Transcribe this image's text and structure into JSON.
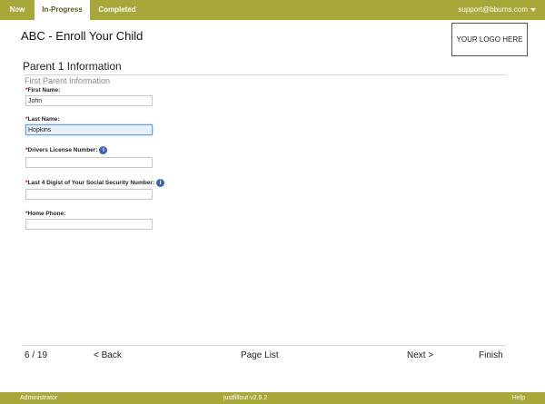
{
  "tabs": [
    {
      "label": "New"
    },
    {
      "label": "In-Progress"
    },
    {
      "label": "Completed"
    }
  ],
  "account": {
    "email": "support@bburns.com"
  },
  "page_title": "ABC - Enroll Your Child",
  "logo_text": "YOUR LOGO HERE",
  "section": {
    "title": "Parent 1 Information",
    "subtitle": "First Parent Information"
  },
  "required_marker": "*",
  "fields": [
    {
      "label": "First Name:",
      "value": "John"
    },
    {
      "label": "Last Name:",
      "value": "Hopkins"
    },
    {
      "label": "Drivers License Number:",
      "value": ""
    },
    {
      "label": "Last 4 Digist of Your Social Security Number:",
      "value": ""
    },
    {
      "label": "Home Phone:",
      "value": ""
    }
  ],
  "nav": {
    "page_counter": "6 / 19",
    "back": "< Back",
    "page_list": "Page List",
    "next": "Next >",
    "finish": "Finish"
  },
  "footer": {
    "left": "Administrator",
    "center": "justfillout v2.9.2",
    "right": "Help"
  },
  "colors": {
    "accent": "#a8a83a",
    "help_icon": "#3a64b8",
    "required": "#cc0000"
  },
  "icons": {
    "help": "help-icon",
    "account_menu": "chevron-down-icon"
  }
}
